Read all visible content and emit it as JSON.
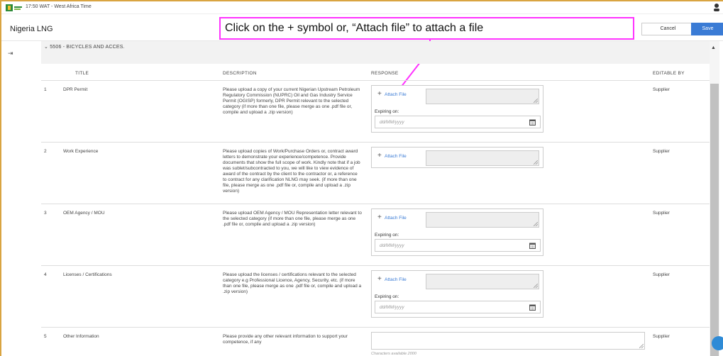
{
  "topbar": {
    "time_label": "17:50 WAT - West Africa Time",
    "logo_icon": "nlng-logo-icon",
    "user_icon": "user-icon"
  },
  "header": {
    "app_title": "Nigeria LNG",
    "cancel_label": "Cancel",
    "save_label": "Save"
  },
  "callout": {
    "text": "Click on the + symbol or, “Attach file” to attach a file",
    "color": "#ff33ff"
  },
  "section": {
    "title": "5506 - BICYCLES AND ACCES."
  },
  "table": {
    "columns": {
      "title": "TITLE",
      "description": "DESCRIPTION",
      "response": "RESPONSE",
      "editable_by": "EDITABLE BY"
    },
    "rows": [
      {
        "num": "1",
        "title": "DPR Permit",
        "description": "Please upload a copy of your current Nigerian Upstream Petroleum Regulatory Commission (NUPRC) Oil and Gas Industry Service Permit (OGISP) formerly, DPR Permit relevant to the selected category (if more than one file, please merge as one .pdf file or, compile and upload a .zip version)",
        "attach_label": "Attach File",
        "expiring_label": "Expiring on:",
        "date_placeholder": "dd/MM/yyyy",
        "editable_by": "Supplier"
      },
      {
        "num": "2",
        "title": "Work Experience",
        "description": "Please upload copies of Work/Purchase Orders or, contract award letters to demonstrate your experience/competence. Provide documents that show the full scope of work. Kindly note that if a job was sublet/subcontracted to you, we will like to view evidence of award of the contract by the client to the contractor or, a reference to contract for any clarification NLNG may seek. (if more than one file, please merge as one .pdf file or, compile and upload a .zip version)",
        "attach_label": "Attach File",
        "editable_by": "Supplier"
      },
      {
        "num": "3",
        "title": "OEM Agency / MOU",
        "description": "Please upload OEM Agency / MOU Representation letter relevant to the selected category (if more than one file, please merge as one .pdf file or, compile and upload a .zip version)",
        "attach_label": "Attach File",
        "expiring_label": "Expiring on:",
        "date_placeholder": "dd/MM/yyyy",
        "editable_by": "Supplier"
      },
      {
        "num": "4",
        "title": "Licenses / Certifications",
        "description": "Please upload the licenses / certifications relevant to the selected category e.g Professional Licence, Agency, Security, etc. (if more than one file, please merge as one .pdf file or, compile and upload a .zip version)",
        "attach_label": "Attach File",
        "expiring_label": "Expiring on:",
        "date_placeholder": "dd/MM/yyyy",
        "editable_by": "Supplier"
      },
      {
        "num": "5",
        "title": "Other Information",
        "description": "Please provide any other relevant information to support your competence, if any",
        "chars_available": "Characters available 2000",
        "editable_by": "Supplier"
      }
    ]
  },
  "colors": {
    "accent": "#3a7bd5",
    "frame": "#d9a441",
    "section_bg": "#f2f2f2"
  }
}
